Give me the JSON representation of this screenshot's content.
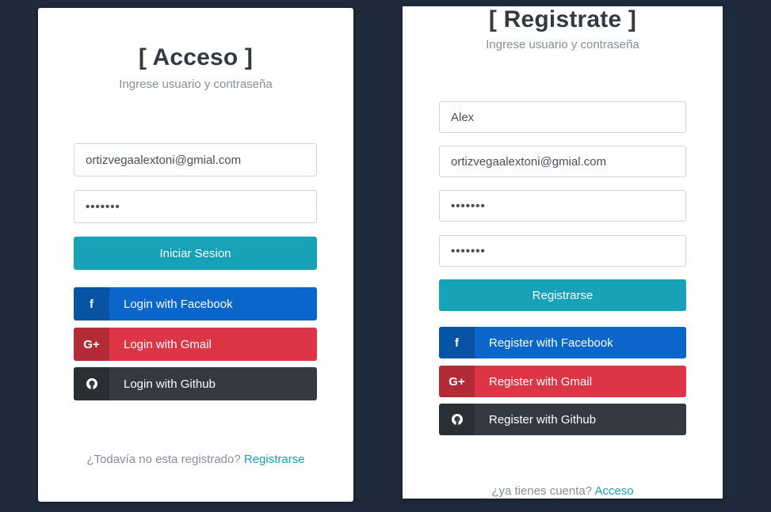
{
  "login": {
    "title": "[ Acceso ]",
    "subtitle": "Ingrese usuario y contraseña",
    "email_value": "ortizvegaalextoni@gmial.com",
    "password_value": "•••••••",
    "submit_label": "Iniciar Sesion",
    "facebook_label": "Login with Facebook",
    "gmail_label": "Login with Gmail",
    "github_label": "Login with Github",
    "footer_text": "¿Todavía no esta registrado?",
    "footer_link": "Registrarse"
  },
  "register": {
    "title": "[ Registrate ]",
    "subtitle": "Ingrese usuario y contraseña",
    "name_value": "Alex",
    "email_value": "ortizvegaalextoni@gmial.com",
    "password_value": "•••••••",
    "password_confirm_value": "•••••••",
    "submit_label": "Registrarse",
    "facebook_label": "Register with Facebook",
    "gmail_label": "Register with Gmail",
    "github_label": "Register with Github",
    "footer_text": "¿ya tienes cuenta?",
    "footer_link": "Acceso"
  },
  "icons": {
    "facebook": "f",
    "gmail": "G+",
    "github": "github-icon"
  },
  "colors": {
    "background": "#1f2a3a",
    "primary": "#17a2b8",
    "facebook": "#0a66c9",
    "gmail": "#dc3545",
    "github": "#343a40"
  }
}
